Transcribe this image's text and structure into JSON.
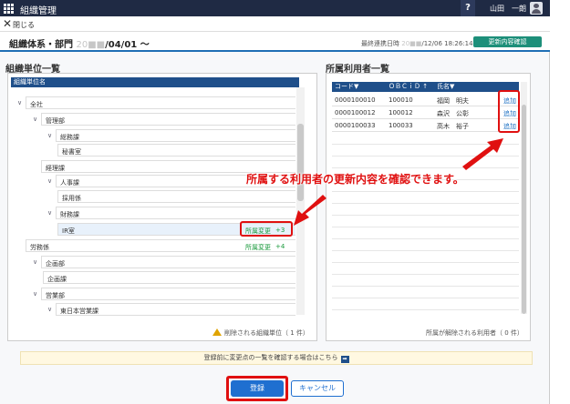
{
  "app": {
    "title": "組織管理",
    "help": "?",
    "user": "山田　一朗"
  },
  "nav": {
    "close": "閉じる"
  },
  "header": {
    "title_prefix": "組織体系・部門",
    "title_date_blur": "20■■",
    "title_date": "/04/01 〜",
    "last_sync_label": "最終連携日時",
    "last_sync_blur": "20■■",
    "last_sync_value": "/12/06 18:26:14",
    "confirm_button": "更新内容確認"
  },
  "left": {
    "section_title": "組織単位一覧",
    "column_header": "組織単位名",
    "tree": [
      {
        "label": "全社",
        "level": 0,
        "chev": "∨"
      },
      {
        "label": "管理部",
        "level": 1,
        "chev": "∨"
      },
      {
        "label": "総務課",
        "level": 2,
        "chev": "∨"
      },
      {
        "label": "秘書室",
        "level": 3,
        "chev": ""
      },
      {
        "label": "経理課",
        "level": 2,
        "chev": ""
      },
      {
        "label": "人事課",
        "level": 2,
        "chev": "∨"
      },
      {
        "label": "採用係",
        "level": 3,
        "chev": ""
      },
      {
        "label": "財務課",
        "level": 2,
        "chev": "∨"
      },
      {
        "label": "IR室",
        "level": 3,
        "chev": ""
      },
      {
        "label": "労務係",
        "level": 1,
        "chev": ""
      },
      {
        "label": "企画部",
        "level": 1,
        "chev": "∨"
      },
      {
        "label": "企画課",
        "level": 2,
        "chev": ""
      },
      {
        "label": "営業部",
        "level": 1,
        "chev": "∨"
      },
      {
        "label": "東日本営業課",
        "level": 2,
        "chev": "∨"
      }
    ],
    "ir_status": "所属変更",
    "ir_count": "+3",
    "labor_status": "所属変更",
    "labor_count": "+4",
    "deleted_note": "削除される組織単位（ 1 件）"
  },
  "right": {
    "section_title": "所属利用者一覧",
    "col_code": "コード▼",
    "col_obcid": "ＯＢＣｉＤ ↑",
    "col_name": "氏名▼",
    "users": [
      {
        "code": "0000100010",
        "obcid": "100010",
        "name": "福岡　明夫",
        "action": "追加"
      },
      {
        "code": "0000100012",
        "obcid": "100012",
        "name": "森沢　公彰",
        "action": "追加"
      },
      {
        "code": "0000100033",
        "obcid": "100033",
        "name": "高木　裕子",
        "action": "追加"
      }
    ],
    "released_note": "所属が解除される利用者（ 0 件）"
  },
  "callout": "所属する利用者の更新内容を確認できます。",
  "info_bar": "登録前に変更点の一覧を確認する場合はこちら",
  "info_arrow": "➡",
  "buttons": {
    "register": "登録",
    "cancel": "キャンセル"
  }
}
